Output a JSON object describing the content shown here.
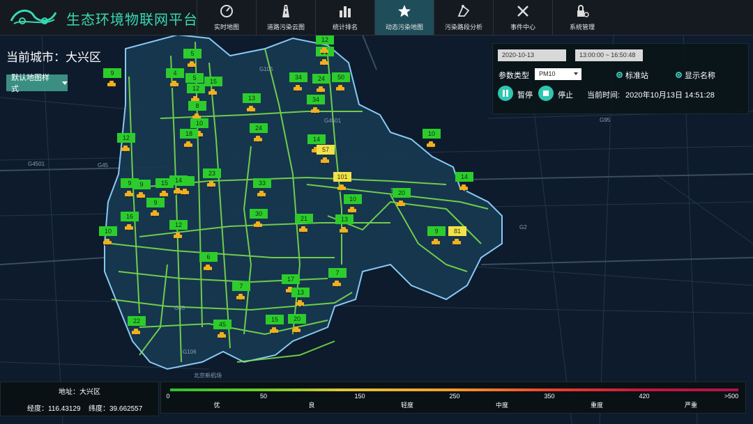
{
  "app": {
    "title": "生态环境物联网平台"
  },
  "nav": [
    {
      "label": "实时地图",
      "icon": "dashboard-icon"
    },
    {
      "label": "道路污染云图",
      "icon": "road-icon"
    },
    {
      "label": "统计排名",
      "icon": "bar-chart-icon"
    },
    {
      "label": "动态污染地图",
      "icon": "star-icon"
    },
    {
      "label": "污染路段分析",
      "icon": "route-analysis-icon"
    },
    {
      "label": "事件中心",
      "icon": "tools-icon"
    },
    {
      "label": "系统管理",
      "icon": "lock-settings-icon"
    }
  ],
  "nav_active": "动态污染地图",
  "city": {
    "label": "当前城市：大兴区"
  },
  "map_style": {
    "label": "默认地图样式"
  },
  "controls": {
    "date": "2020-10-13",
    "time_range": "13:00:00 ~ 16:50:48",
    "param_label": "参数类型",
    "param_value": "PM10",
    "standard_station": "标准站",
    "show_name": "显示名称",
    "pause": "暂停",
    "stop": "停止",
    "current_time_label": "当前时间:",
    "current_time": "2020年10月13日 14:51:28"
  },
  "location": {
    "address": "地址：大兴区",
    "lng": "经度：116.43129",
    "lat": "纬度：39.662557"
  },
  "legend": {
    "ticks": [
      "0",
      "50",
      "150",
      "250",
      "350",
      "420",
      ">500"
    ],
    "categories": [
      "优",
      "良",
      "轻度",
      "中度",
      "重度",
      "严重"
    ]
  },
  "colors": {
    "good": "#2dcc2d",
    "moderate": "#f2e24a",
    "accent": "#39d9b4",
    "road": "#7fe84a"
  },
  "stations": [
    {
      "value": "5",
      "level": "good"
    },
    {
      "value": "14",
      "level": "good"
    },
    {
      "value": "12",
      "level": "good"
    },
    {
      "value": "9",
      "level": "good"
    },
    {
      "value": "4",
      "level": "good"
    },
    {
      "value": "15",
      "level": "good"
    },
    {
      "value": "5",
      "level": "good"
    },
    {
      "value": "12",
      "level": "good"
    },
    {
      "value": "34",
      "level": "good"
    },
    {
      "value": "24",
      "level": "good"
    },
    {
      "value": "50",
      "level": "good"
    },
    {
      "value": "8",
      "level": "good"
    },
    {
      "value": "13",
      "level": "good"
    },
    {
      "value": "34",
      "level": "good"
    },
    {
      "value": "10",
      "level": "good"
    },
    {
      "value": "24",
      "level": "good"
    },
    {
      "value": "18",
      "level": "good"
    },
    {
      "value": "12",
      "level": "good"
    },
    {
      "value": "14",
      "level": "good"
    },
    {
      "value": "57",
      "level": "moderate"
    },
    {
      "value": "10",
      "level": "good"
    },
    {
      "value": "14",
      "level": "good"
    },
    {
      "value": "23",
      "level": "good"
    },
    {
      "value": "9",
      "level": "good"
    },
    {
      "value": "9",
      "level": "good"
    },
    {
      "value": "15",
      "level": "good"
    },
    {
      "value": "8",
      "level": "good"
    },
    {
      "value": "33",
      "level": "good"
    },
    {
      "value": "101",
      "level": "moderate"
    },
    {
      "value": "14",
      "level": "good"
    },
    {
      "value": "20",
      "level": "good"
    },
    {
      "value": "10",
      "level": "good"
    },
    {
      "value": "9",
      "level": "good"
    },
    {
      "value": "16",
      "level": "good"
    },
    {
      "value": "30",
      "level": "good"
    },
    {
      "value": "21",
      "level": "good"
    },
    {
      "value": "13",
      "level": "good"
    },
    {
      "value": "12",
      "level": "good"
    },
    {
      "value": "10",
      "level": "good"
    },
    {
      "value": "9",
      "level": "good"
    },
    {
      "value": "81",
      "level": "moderate"
    },
    {
      "value": "6",
      "level": "good"
    },
    {
      "value": "17",
      "level": "good"
    },
    {
      "value": "7",
      "level": "good"
    },
    {
      "value": "7",
      "level": "good"
    },
    {
      "value": "13",
      "level": "good"
    },
    {
      "value": "22",
      "level": "good"
    },
    {
      "value": "45",
      "level": "good"
    },
    {
      "value": "15",
      "level": "good"
    },
    {
      "value": "20",
      "level": "good"
    }
  ],
  "map_labels": [
    "G106",
    "G105",
    "G4501",
    "G45",
    "G4501",
    "G2",
    "G95",
    "S2",
    "北京新机场"
  ]
}
